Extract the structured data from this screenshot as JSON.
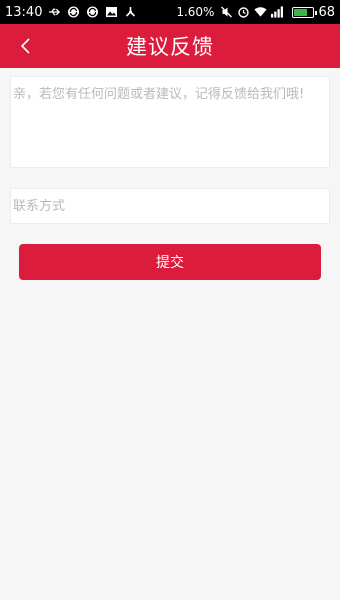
{
  "status_bar": {
    "time": "13:40",
    "battery_percent_text": "1.60%",
    "battery_level": "68",
    "icons_left": [
      "usb-icon",
      "sync-icon",
      "sync-icon",
      "image-icon",
      "network-icon"
    ],
    "icons_right": [
      "mute-icon",
      "alarm-icon",
      "wifi-icon",
      "signal-icon",
      "battery-icon"
    ]
  },
  "header": {
    "title": "建议反馈",
    "back_icon": "chevron-left-icon",
    "background_color": "#dc1c3c"
  },
  "form": {
    "feedback_placeholder": "亲，若您有任何问题或者建议，记得反馈给我们哦!",
    "feedback_value": "",
    "contact_placeholder": "联系方式",
    "contact_value": "",
    "submit_label": "提交"
  }
}
